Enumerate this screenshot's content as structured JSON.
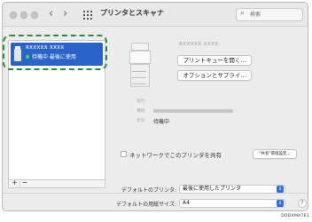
{
  "window": {
    "title": "プリンタとスキャナ",
    "search_placeholder": "検索"
  },
  "sidebar": {
    "items": [
      {
        "name": "RXXXXX XXXX",
        "status": "待機中 最後に使用"
      }
    ],
    "add_label": "+",
    "remove_label": "−"
  },
  "detail": {
    "printer_name": "RXXXXX XXXX",
    "open_queue_label": "プリントキューを開く...",
    "options_label": "オプションとサプライ...",
    "location_label": "場所:",
    "kind_label": "種類:",
    "state_label": "状況:",
    "state_value": "待機中"
  },
  "share": {
    "label": "ネットワークでこのプリンタを共有",
    "prefs_button": "\"共有\"環境設定..."
  },
  "defaults": {
    "printer_label": "デフォルトのプリンタ:",
    "printer_value": "最後に使用したプリンタ",
    "paper_label": "デフォルトの用紙サイズ:",
    "paper_value": "A4"
  },
  "help_label": "?",
  "figure_code": "DDDXMA761",
  "colors": {
    "selection": "#2b64c9",
    "highlight_outline": "#2a8a3a",
    "status_dot": "#3fd94b"
  }
}
